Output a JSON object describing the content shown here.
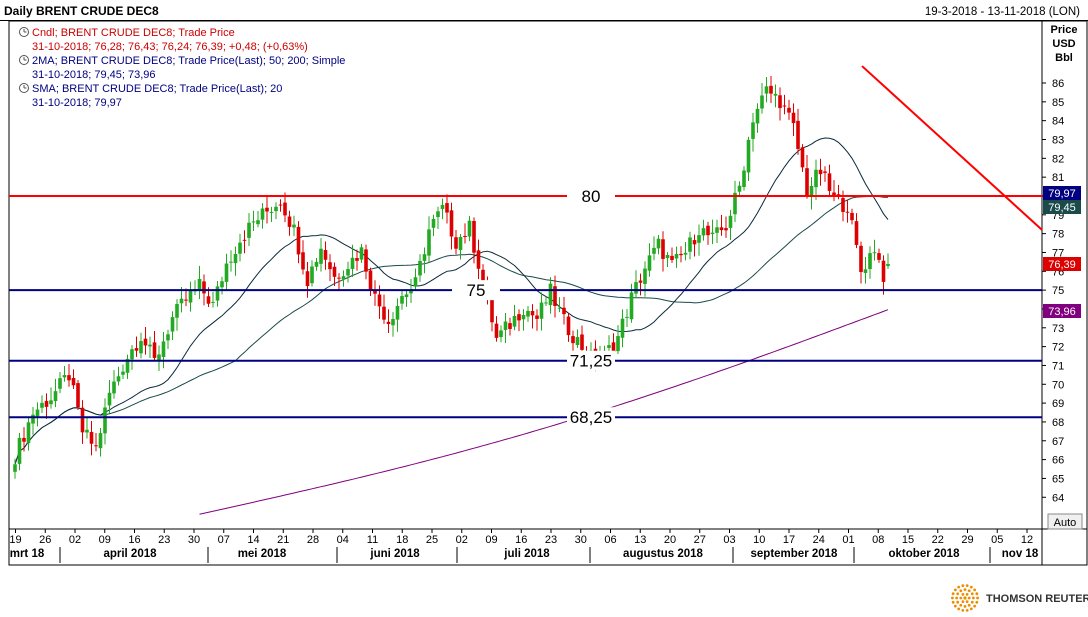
{
  "header": {
    "title": "Daily BRENT CRUDE DEC8",
    "date_range": "19-3-2018 - 13-11-2018 (LON)"
  },
  "legend": [
    {
      "line1": "Cndl; BRENT CRUDE DEC8; Trade Price",
      "line2": "31-10-2018; 76,28; 76,43; 76,24; 76,39; +0,48; (+0,63%)",
      "color": "#cc0000",
      "line2_color": "#cc0000"
    },
    {
      "line1": "2MA; BRENT CRUDE DEC8; Trade Price(Last); 50; 200; Simple",
      "line2": "31-10-2018; 79,45; 73,96",
      "color": "#000080",
      "line2_color": "#000080"
    },
    {
      "line1": "SMA; BRENT CRUDE DEC8; Trade Price(Last); 20",
      "line2": "31-10-2018; 79,97",
      "color": "#000080",
      "line2_color": "#000080"
    }
  ],
  "axis": {
    "title_lines": [
      "Price",
      "USD",
      "Bbl"
    ],
    "auto_button": "Auto"
  },
  "brand": {
    "name": "THOMSON REUTERS"
  },
  "colors": {
    "up": "#22aa22",
    "down": "#dd0000",
    "level": "#000080",
    "resistance": "#ff0000",
    "ma50": "#1a4a4a",
    "ma200": "#800080",
    "sma20": "#0a2a3a"
  },
  "chart_data": {
    "type": "candlestick",
    "ylim": [
      63,
      87
    ],
    "yticks": [
      64,
      65,
      66,
      67,
      68,
      69,
      70,
      71,
      72,
      73,
      74,
      75,
      76,
      77,
      78,
      79,
      80,
      81,
      82,
      83,
      84,
      85,
      86
    ],
    "x_day_ticks": [
      "19",
      "26",
      "02",
      "09",
      "16",
      "23",
      "30",
      "07",
      "14",
      "21",
      "28",
      "04",
      "11",
      "18",
      "25",
      "02",
      "09",
      "16",
      "23",
      "30",
      "06",
      "13",
      "20",
      "27",
      "03",
      "10",
      "17",
      "24",
      "01",
      "08",
      "15",
      "22",
      "29",
      "05",
      "12"
    ],
    "x_months": [
      "mrt 18",
      "april 2018",
      "mei 2018",
      "juni 2018",
      "juli 2018",
      "augustus 2018",
      "september 2018",
      "oktober 2018",
      "nov 18"
    ],
    "horizontal_levels": [
      {
        "value": 80,
        "label": "80",
        "color": "#ff0000"
      },
      {
        "value": 75,
        "label": "75",
        "color": "#000080"
      },
      {
        "value": 71.25,
        "label": "71,25",
        "color": "#000080"
      },
      {
        "value": 68.25,
        "label": "68,25",
        "color": "#000080"
      }
    ],
    "trendline": {
      "from": [
        86.9,
        "2018-10-03"
      ],
      "to": [
        78.2,
        "2018-11-12"
      ]
    },
    "badges": [
      {
        "value": 79.97,
        "text": "79,97",
        "color": "#000080"
      },
      {
        "value": 79.45,
        "text": "79,45",
        "color": "#1a4a4a"
      },
      {
        "value": 76.39,
        "text": "76,39",
        "color": "#dd0000"
      },
      {
        "value": 73.96,
        "text": "73,96",
        "color": "#800080"
      }
    ],
    "anchors": [
      {
        "d": 0,
        "v": 66.2
      },
      {
        "d": 4,
        "v": 68.5
      },
      {
        "d": 8,
        "v": 69.3
      },
      {
        "d": 12,
        "v": 70.5
      },
      {
        "d": 15,
        "v": 67.5
      },
      {
        "d": 18,
        "v": 66.6
      },
      {
        "d": 21,
        "v": 69.5
      },
      {
        "d": 25,
        "v": 71.5
      },
      {
        "d": 28,
        "v": 72.6
      },
      {
        "d": 31,
        "v": 71.2
      },
      {
        "d": 35,
        "v": 73.5
      },
      {
        "d": 38,
        "v": 74.5
      },
      {
        "d": 41,
        "v": 75.2
      },
      {
        "d": 44,
        "v": 74.2
      },
      {
        "d": 47,
        "v": 76.4
      },
      {
        "d": 50,
        "v": 77.7
      },
      {
        "d": 53,
        "v": 78.6
      },
      {
        "d": 56,
        "v": 79.2
      },
      {
        "d": 59,
        "v": 79.8
      },
      {
        "d": 62,
        "v": 78.2
      },
      {
        "d": 65,
        "v": 75.6
      },
      {
        "d": 68,
        "v": 77.3
      },
      {
        "d": 71,
        "v": 75.7
      },
      {
        "d": 74,
        "v": 76.4
      },
      {
        "d": 77,
        "v": 77.1
      },
      {
        "d": 80,
        "v": 74.6
      },
      {
        "d": 83,
        "v": 73.4
      },
      {
        "d": 86,
        "v": 74.7
      },
      {
        "d": 89,
        "v": 75.3
      },
      {
        "d": 92,
        "v": 78.2
      },
      {
        "d": 95,
        "v": 79.3
      },
      {
        "d": 98,
        "v": 77.6
      },
      {
        "d": 101,
        "v": 78.3
      },
      {
        "d": 104,
        "v": 75.5
      },
      {
        "d": 107,
        "v": 72.4
      },
      {
        "d": 110,
        "v": 73.2
      },
      {
        "d": 113,
        "v": 74.1
      },
      {
        "d": 116,
        "v": 73.5
      },
      {
        "d": 119,
        "v": 74.9
      },
      {
        "d": 122,
        "v": 73.3
      },
      {
        "d": 125,
        "v": 72.3
      },
      {
        "d": 128,
        "v": 71.4
      },
      {
        "d": 131,
        "v": 71.5
      },
      {
        "d": 134,
        "v": 72.5
      },
      {
        "d": 137,
        "v": 74.6
      },
      {
        "d": 140,
        "v": 76.2
      },
      {
        "d": 143,
        "v": 77.4
      },
      {
        "d": 146,
        "v": 76.3
      },
      {
        "d": 149,
        "v": 77.0
      },
      {
        "d": 152,
        "v": 78.3
      },
      {
        "d": 155,
        "v": 77.7
      },
      {
        "d": 158,
        "v": 78.4
      },
      {
        "d": 161,
        "v": 80.5
      },
      {
        "d": 164,
        "v": 84.2
      },
      {
        "d": 167,
        "v": 85.6
      },
      {
        "d": 170,
        "v": 85.1
      },
      {
        "d": 173,
        "v": 83.6
      },
      {
        "d": 176,
        "v": 80.3
      },
      {
        "d": 179,
        "v": 81.3
      },
      {
        "d": 182,
        "v": 79.8
      },
      {
        "d": 185,
        "v": 79.5
      },
      {
        "d": 187,
        "v": 77.2
      },
      {
        "d": 188,
        "v": 76.0
      },
      {
        "d": 191,
        "v": 77.3
      },
      {
        "d": 193,
        "v": 75.8
      },
      {
        "d": 194,
        "v": 76.39
      }
    ]
  }
}
